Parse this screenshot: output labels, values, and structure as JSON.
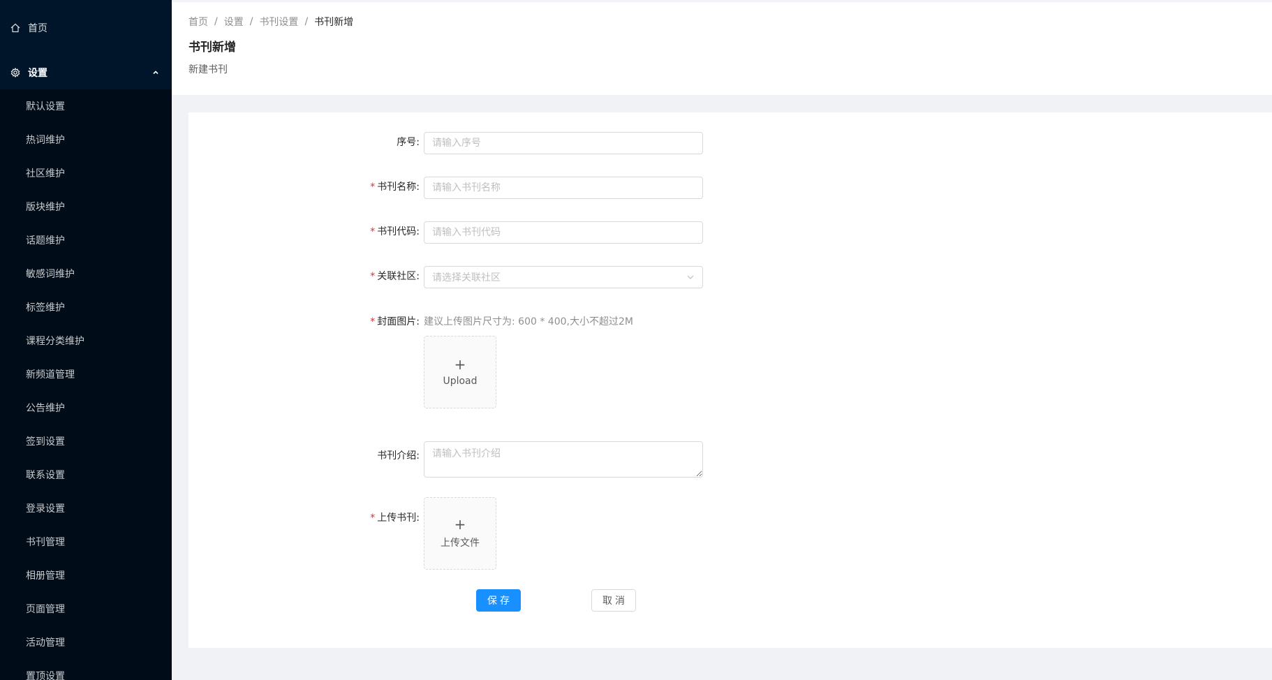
{
  "sidebar": {
    "home": {
      "label": "首页",
      "icon": "home-icon"
    },
    "group": {
      "label": "设置",
      "icon": "gear-icon",
      "expanded": true
    },
    "items": [
      {
        "label": "默认设置"
      },
      {
        "label": "热词维护"
      },
      {
        "label": "社区维护"
      },
      {
        "label": "版块维护"
      },
      {
        "label": "话题维护"
      },
      {
        "label": "敏感词维护"
      },
      {
        "label": "标签维护"
      },
      {
        "label": "课程分类维护"
      },
      {
        "label": "新频道管理"
      },
      {
        "label": "公告维护"
      },
      {
        "label": "签到设置"
      },
      {
        "label": "联系设置"
      },
      {
        "label": "登录设置"
      },
      {
        "label": "书刊管理"
      },
      {
        "label": "相册管理"
      },
      {
        "label": "页面管理"
      },
      {
        "label": "活动管理"
      },
      {
        "label": "置顶设置"
      }
    ]
  },
  "header": {
    "breadcrumb": [
      "首页",
      "设置",
      "书刊设置",
      "书刊新增"
    ],
    "separator": "/",
    "title": "书刊新增",
    "description": "新建书刊"
  },
  "form": {
    "seq": {
      "label": "序号:",
      "placeholder": "请输入序号",
      "value": ""
    },
    "name": {
      "required_mark": "*",
      "label": "书刊名称:",
      "placeholder": "请输入书刊名称",
      "value": ""
    },
    "code": {
      "required_mark": "*",
      "label": "书刊代码:",
      "placeholder": "请输入书刊代码",
      "value": ""
    },
    "community": {
      "required_mark": "*",
      "label": "关联社区:",
      "placeholder": "请选择关联社区"
    },
    "cover": {
      "required_mark": "*",
      "label": "封面图片:",
      "hint": "建议上传图片尺寸为: 600 * 400,大小不超过2M",
      "upload_plus": "+",
      "upload_label": "Upload"
    },
    "intro": {
      "label": "书刊介绍:",
      "placeholder": "请输入书刊介绍",
      "value": ""
    },
    "file": {
      "required_mark": "*",
      "label": "上传书刊:",
      "upload_plus": "+",
      "upload_label": "上传文件"
    },
    "save_label": "保存",
    "cancel_label": "取消"
  },
  "colors": {
    "sidebar_bg": "#001529",
    "submenu_bg": "#000c17",
    "primary": "#1890ff",
    "required": "#f5222d"
  }
}
